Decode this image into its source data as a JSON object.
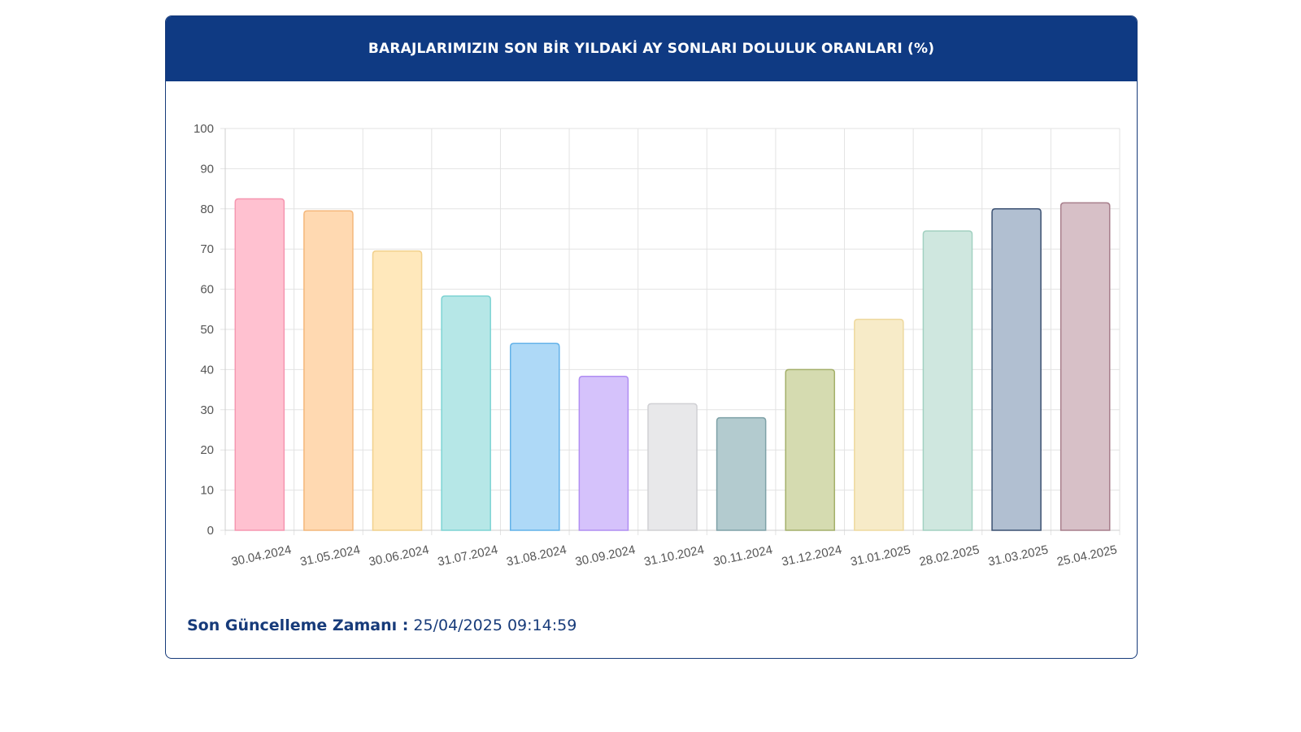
{
  "panel": {
    "title": "BARAJLARIMIZIN SON BİR YILDAKİ AY SONLARI DOLULUK ORANLARI (%)"
  },
  "footer": {
    "label": "Son Güncelleme Zamanı :",
    "value": "25/04/2025 09:14:59"
  },
  "chart_data": {
    "type": "bar",
    "title": "BARAJLARIMIZIN SON BİR YILDAKİ AY SONLARI DOLULUK ORANLARI (%)",
    "xlabel": "",
    "ylabel": "",
    "ylim": [
      0,
      100
    ],
    "yticks": [
      0,
      10,
      20,
      30,
      40,
      50,
      60,
      70,
      80,
      90,
      100
    ],
    "grid": true,
    "categories": [
      "30.04.2024",
      "31.05.2024",
      "30.06.2024",
      "31.07.2024",
      "31.08.2024",
      "30.09.2024",
      "31.10.2024",
      "30.11.2024",
      "31.12.2024",
      "31.01.2025",
      "28.02.2025",
      "31.03.2025",
      "25.04.2025"
    ],
    "values": [
      82.5,
      79.5,
      69.5,
      58.3,
      46.5,
      38.3,
      31.5,
      28.0,
      40.0,
      52.5,
      74.5,
      80.0,
      81.5
    ],
    "fill_colors": [
      "#ffc1d0",
      "#ffd9b1",
      "#ffe8bb",
      "#b6e7e7",
      "#aed9f7",
      "#d5c2fb",
      "#e8e8ea",
      "#b3cbcf",
      "#d5dbb0",
      "#f7ebc8",
      "#cfe7df",
      "#b1bfd1",
      "#d7c0c7"
    ],
    "border_colors": [
      "#f596b0",
      "#f4b77a",
      "#f1d08c",
      "#7dd3d3",
      "#62b2e9",
      "#b08ef2",
      "#d0d0d4",
      "#7ea1a7",
      "#a4b06a",
      "#eed99e",
      "#a2d1c1",
      "#3b5172",
      "#a77e8b"
    ]
  }
}
